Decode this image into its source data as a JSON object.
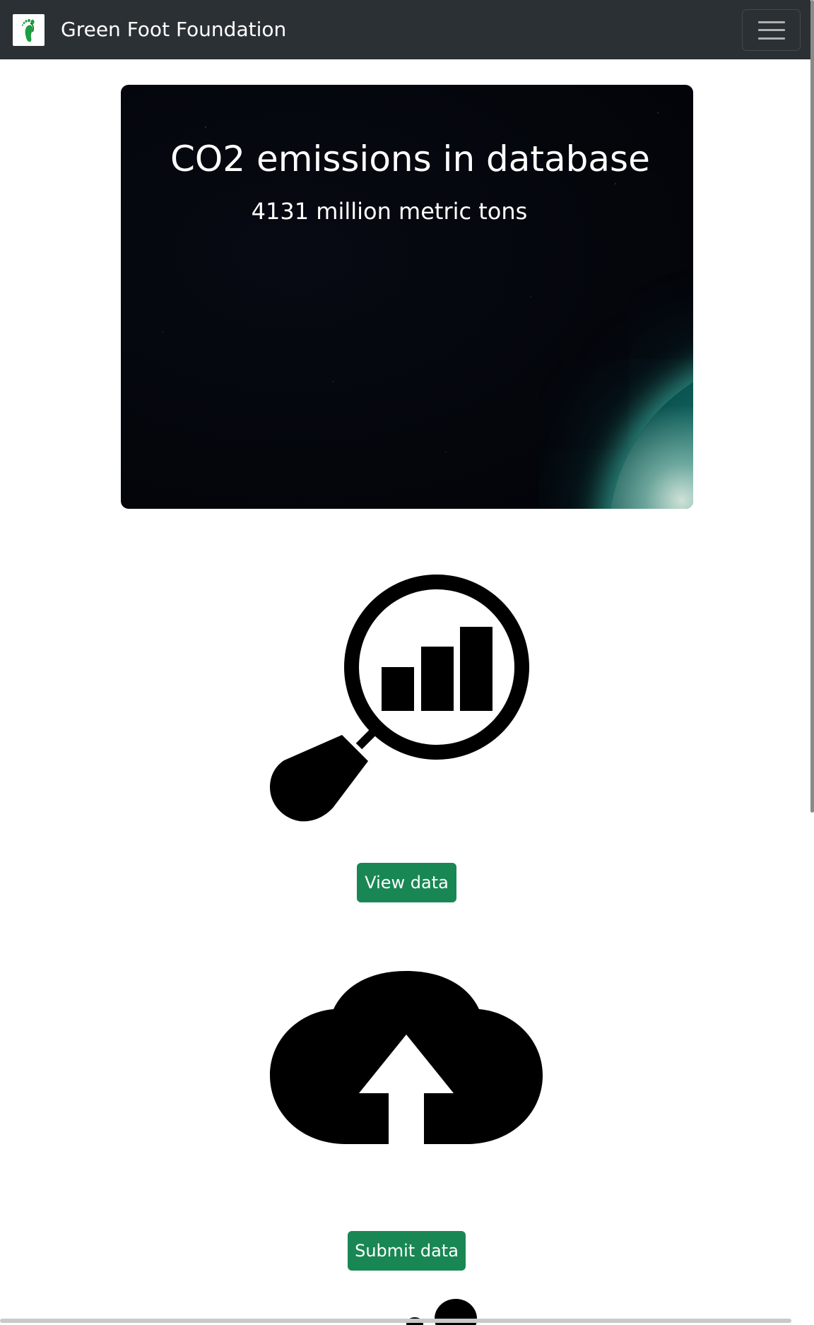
{
  "navbar": {
    "brand": "Green Foot Foundation",
    "logo_icon": "green-footprint-logo",
    "toggler_icon": "hamburger-menu-icon",
    "background": "#2b3035"
  },
  "hero": {
    "title": "CO2 emissions in database",
    "subtitle": "4131 million metric tons",
    "background_image": "earth-from-space"
  },
  "sections": [
    {
      "icon": "magnifier-bar-chart-icon",
      "button_label": "View data"
    },
    {
      "icon": "cloud-upload-icon",
      "button_label": "Submit data"
    },
    {
      "icon": "footprints-icon"
    }
  ],
  "colors": {
    "accent_button": "#198754",
    "logo_green": "#1a9e3f"
  }
}
